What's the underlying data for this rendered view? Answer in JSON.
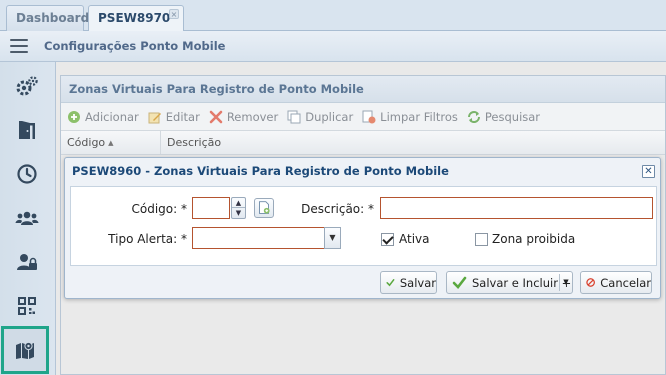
{
  "tabs": [
    {
      "label": "Dashboard"
    },
    {
      "label": "PSEW8970",
      "close": "×"
    }
  ],
  "header": {
    "title": "Configurações Ponto Mobile"
  },
  "sidebar": {
    "items": [
      {
        "icon": "gears-icon"
      },
      {
        "icon": "door-icon"
      },
      {
        "icon": "clock-icon"
      },
      {
        "icon": "users-icon"
      },
      {
        "icon": "user-lock-icon"
      },
      {
        "icon": "qr-code-icon"
      },
      {
        "icon": "map-icon",
        "active": true
      }
    ],
    "active_color": "#1fa58a"
  },
  "panel": {
    "title": "Zonas Virtuais Para Registro de Ponto Mobile",
    "toolbar": {
      "add": "Adicionar",
      "edit": "Editar",
      "remove": "Remover",
      "duplicate": "Duplicar",
      "clear_filters": "Limpar Filtros",
      "search": "Pesquisar"
    },
    "columns": {
      "code": "Código",
      "description": "Descrição"
    }
  },
  "dialog": {
    "title": "PSEW8960 - Zonas Virtuais Para Registro de Ponto Mobile",
    "close": "✕",
    "fields": {
      "codigo_label": "Código: *",
      "codigo_value": "",
      "descricao_label": "Descrição: *",
      "descricao_value": "",
      "tipo_alerta_label": "Tipo Alerta: *",
      "tipo_alerta_value": "",
      "ativa_label": "Ativa",
      "ativa_checked": true,
      "zona_proibida_label": "Zona proibida",
      "zona_proibida_checked": false
    },
    "buttons": {
      "save": "Salvar",
      "save_and_add": "Salvar e Incluir +",
      "cancel": "Cancelar"
    }
  }
}
